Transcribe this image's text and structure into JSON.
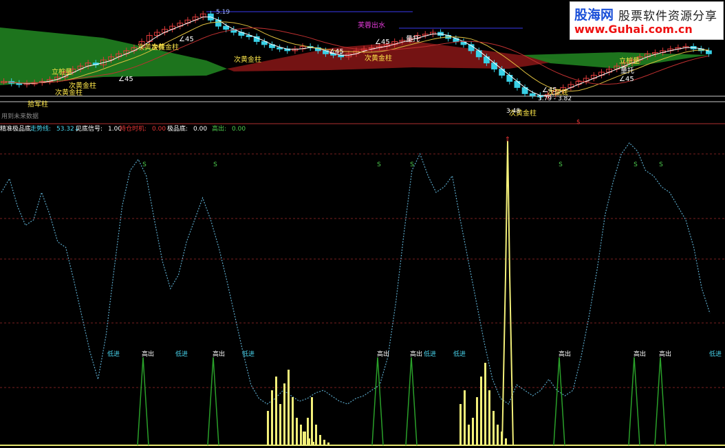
{
  "chart_data": [
    {
      "type": "candlestick",
      "title": "",
      "price_labels": {
        "high": "5.19",
        "range": "3.79 - 3.82",
        "low": "3.48"
      },
      "annotations": [
        "次黄金柱",
        "次黄金柱",
        "次黄金柱",
        "次黄金柱",
        "次黄金柱",
        "次黄金柱",
        "次黄金柱",
        "∠45",
        "∠45",
        "∠45",
        "∠45",
        "∠45",
        "∠45",
        "芙蓉出水",
        "量托",
        "量托",
        "拾军柱",
        "立桩量",
        "立桩量",
        "次鼠底"
      ],
      "footer_text": "用到未来数据",
      "close": [
        4.05,
        4.02,
        4.0,
        4.02,
        4.03,
        4.05,
        4.08,
        4.12,
        4.2,
        4.25,
        4.3,
        4.35,
        4.32,
        4.4,
        4.45,
        4.5,
        4.55,
        4.6,
        4.7,
        4.8,
        4.85,
        4.9,
        4.95,
        5.0,
        5.05,
        5.1,
        5.15,
        5.05,
        4.95,
        4.9,
        4.85,
        4.8,
        4.78,
        4.7,
        4.65,
        4.6,
        4.58,
        4.55,
        4.58,
        4.62,
        4.6,
        4.55,
        4.5,
        4.48,
        4.45,
        4.5,
        4.55,
        4.58,
        4.6,
        4.62,
        4.65,
        4.7,
        4.72,
        4.75,
        4.8,
        4.82,
        4.85,
        4.8,
        4.75,
        4.7,
        4.65,
        4.55,
        4.45,
        4.35,
        4.25,
        4.15,
        4.05,
        3.95,
        3.85,
        3.82,
        3.8,
        3.84,
        3.9,
        3.95,
        4.0,
        4.05,
        4.1,
        4.15,
        4.2,
        4.25,
        4.3,
        4.35,
        4.4,
        4.45,
        4.5,
        4.52,
        4.55,
        4.58,
        4.6,
        4.62,
        4.58,
        4.55,
        4.5
      ]
    },
    {
      "type": "line",
      "indicator_values": [
        {
          "label": "精准极品底",
          "value": ""
        },
        {
          "label": "走势线:",
          "value": "53.32↓"
        },
        {
          "label": "见底信号:",
          "value": "1.00"
        },
        {
          "label": "持仓时机:",
          "value": "0.00"
        },
        {
          "label": "极品底:",
          "value": "0.00"
        },
        {
          "label": "高出:",
          "value": "0.00"
        }
      ],
      "signal_labels": [
        "S",
        "S",
        "S",
        "S",
        "S",
        "S",
        "S",
        "S"
      ],
      "trend_line": [
        80,
        85,
        75,
        68,
        70,
        80,
        72,
        62,
        60,
        48,
        35,
        22,
        12,
        28,
        52,
        75,
        88,
        92,
        86,
        70,
        55,
        45,
        50,
        62,
        70,
        78,
        70,
        60,
        48,
        35,
        22,
        10,
        5,
        3,
        5,
        8,
        6,
        4,
        5,
        7,
        8,
        6,
        4,
        3,
        5,
        6,
        8,
        10,
        20,
        40,
        65,
        88,
        94,
        86,
        80,
        82,
        86,
        70,
        55,
        40,
        25,
        12,
        5,
        3,
        10,
        8,
        6,
        8,
        12,
        8,
        6,
        8,
        20,
        35,
        52,
        72,
        84,
        94,
        98,
        95,
        88,
        86,
        82,
        80,
        75,
        70,
        60,
        45,
        36
      ],
      "markers": [
        "低进",
        "高出",
        "低进",
        "高出",
        "低进",
        "高出",
        "高出",
        "低进",
        "低进",
        "高出",
        "高出",
        "高出",
        "低进"
      ],
      "spike_max": "1.00"
    }
  ],
  "colors": {
    "bg": "#000000",
    "up": "#e03a3a",
    "down": "#38d0e6",
    "ma": "#ffffff",
    "green_band": "#1f7a1f",
    "red_band": "#7a1414",
    "trend": "#5aa7c8",
    "bars": "#f3f07a",
    "spikes": "#2aa12a",
    "label_yellow": "#ffe84a",
    "label_pink": "#e63bdc",
    "label_cyan": "#49d7f0",
    "label_red": "#e83535",
    "label_green": "#4fd04f"
  },
  "watermark": {
    "cn": "股海网",
    "cn2": "股票软件资源分享",
    "url": "www.Guhai.com.cn"
  }
}
